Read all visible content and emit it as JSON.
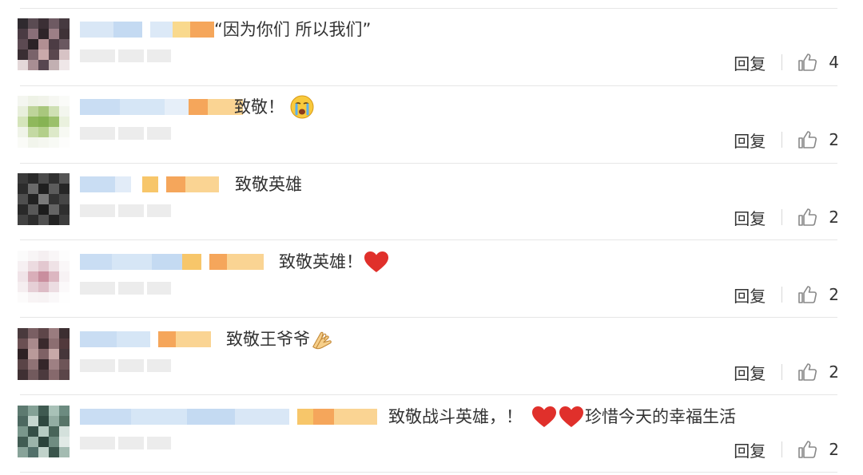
{
  "comments": [
    {
      "text": "“因为你们 所以我们”",
      "emoji": [],
      "reply_label": "回复",
      "likes": "4"
    },
    {
      "text": "致敬！",
      "emoji": [
        "crying-face"
      ],
      "reply_label": "回复",
      "likes": "2"
    },
    {
      "text": "致敬英雄",
      "emoji": [],
      "reply_label": "回复",
      "likes": "2"
    },
    {
      "text": "致敬英雄！",
      "emoji": [
        "red-heart"
      ],
      "reply_label": "回复",
      "likes": "2"
    },
    {
      "text": "致敬王爷爷",
      "emoji": [
        "folded-hands"
      ],
      "reply_label": "回复",
      "likes": "2"
    },
    {
      "text": "致敬战斗英雄，！",
      "emoji": [
        "red-heart",
        "red-heart"
      ],
      "text_after": "珍惜今天的幸福生活",
      "reply_label": "回复",
      "likes": "2"
    }
  ],
  "colors": {
    "text": "#333333",
    "divider": "#e6e6e6",
    "icon": "#888888",
    "blurred_name_blue": "#c9ddf3",
    "blurred_badge_orange": "#f7c66a",
    "heart": "#e0302b"
  }
}
